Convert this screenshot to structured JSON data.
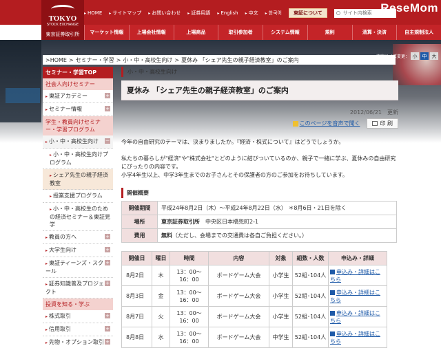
{
  "logo": {
    "line1": "TOKYO",
    "line2": "STOCK EXCHANGE",
    "line3": "東京証券取引所"
  },
  "utility": {
    "links": [
      "HOME",
      "サイトマップ",
      "お問い合わせ",
      "証券用語",
      "English",
      "中文",
      "한국어"
    ],
    "about_button": "東証について",
    "search_placeholder": "サイト内検索"
  },
  "brand_watermark": "ReseMom",
  "nav": [
    "マーケット情報",
    "上場会社情報",
    "上場商品",
    "取引参加者",
    "システム情報",
    "規則",
    "清算・決済",
    "自主規制法人"
  ],
  "font_size": {
    "label": "文字サイズ変更：",
    "options": [
      "小",
      "中",
      "大"
    ],
    "selected": "中"
  },
  "breadcrumb": [
    "HOME",
    "セミナー・学習",
    "小・中・高校生向け",
    "夏休み 「シェア先生の親子経済教室」のご案内"
  ],
  "sidebar": {
    "header": "セミナー・学習TOP",
    "items": [
      {
        "type": "sec",
        "label": "社会人向けセミナー"
      },
      {
        "type": "item",
        "label": "東証アカデミー",
        "plus": "+"
      },
      {
        "type": "item",
        "label": "セミナー情報",
        "plus": "+"
      },
      {
        "type": "sec",
        "label": "学生・教員向けセミナー・学習プログラム"
      },
      {
        "type": "item",
        "label": "小・中・高校生向け",
        "plus": "－",
        "open": true
      },
      {
        "type": "sub",
        "label": "小・中・高校生向けプログラム"
      },
      {
        "type": "sub",
        "label": "シェア先生の親子経済教室",
        "current": true
      },
      {
        "type": "sub",
        "label": "授業支援プログラム"
      },
      {
        "type": "sub",
        "label": "小・中・高校生のための経済セミナー＆東証見学"
      },
      {
        "type": "item",
        "label": "教員の方へ",
        "plus": "+"
      },
      {
        "type": "item",
        "label": "大学生向け",
        "plus": "+"
      },
      {
        "type": "item",
        "label": "東証ティーンズ・スクール",
        "plus": "+"
      },
      {
        "type": "item",
        "label": "証券知識普及プロジェクト",
        "plus": "+"
      },
      {
        "type": "sec",
        "label": "投資を知る・学ぶ"
      },
      {
        "type": "item",
        "label": "株式取引",
        "plus": "+"
      },
      {
        "type": "item",
        "label": "信用取引",
        "plus": "+"
      },
      {
        "type": "item",
        "label": "先物・オプション取引",
        "plus": "+"
      }
    ]
  },
  "main": {
    "section_label": "小・中・高校生向け",
    "title": "夏休み 「シェア先生の親子経済教室」のご案内",
    "date": "2012/06/21",
    "date_suffix": "更新",
    "audio_link": "このページを音声で聞く",
    "print_button": "印 刷",
    "para1": "今年の自由研究のテーマは、決まりましたか。『経済・株式について』はどうでしょうか。",
    "para2": "私たちの暮らしが\"経済\"や\"株式会社\"とどのように結びついているのか、親子で一緒に学ぶ、夏休みの自由研究にぴったりの内容です。",
    "para3": "小学4年生以上、中学3年生までのお子さんとその保護者の方のご参加をお待ちしています。",
    "overview_heading": "開催概要",
    "overview": [
      {
        "label": "開催期間",
        "value": "平成24年8月2日（木）〜平成24年8月22日（水） ＊8月6日・21日を除く"
      },
      {
        "label": "場所",
        "value_bold": "東京証券取引所",
        "value": "中央区日本橋兜町2-1"
      },
      {
        "label": "費用",
        "value_bold": "無料",
        "value": "（ただし、会場までの交通費は各自ご負担ください。）"
      }
    ],
    "schedule_headers": [
      "開催日",
      "曜日",
      "時間",
      "内容",
      "対象",
      "組数・人数",
      "申込み・詳細"
    ],
    "schedule": [
      {
        "date": "8月2日",
        "day": "木",
        "time": "13：00〜16：00",
        "content": "ボードゲーム大会",
        "target": "小学生",
        "count": "52組･104人",
        "apply": "申込み・詳細はこちら"
      },
      {
        "date": "8月3日",
        "day": "金",
        "time": "13：00〜16：00",
        "content": "ボードゲーム大会",
        "target": "小学生",
        "count": "52組･104人",
        "apply": "申込み・詳細はこちら"
      },
      {
        "date": "8月7日",
        "day": "火",
        "time": "13：00〜16：00",
        "content": "ボードゲーム大会",
        "target": "小学生",
        "count": "52組･104人",
        "apply": "申込み・詳細はこちら"
      },
      {
        "date": "8月8日",
        "day": "水",
        "time": "13：00〜16：00",
        "content": "ボードゲーム大会",
        "target": "中学生",
        "count": "52組･104人",
        "apply": "申込み・詳細はこちら"
      }
    ]
  }
}
